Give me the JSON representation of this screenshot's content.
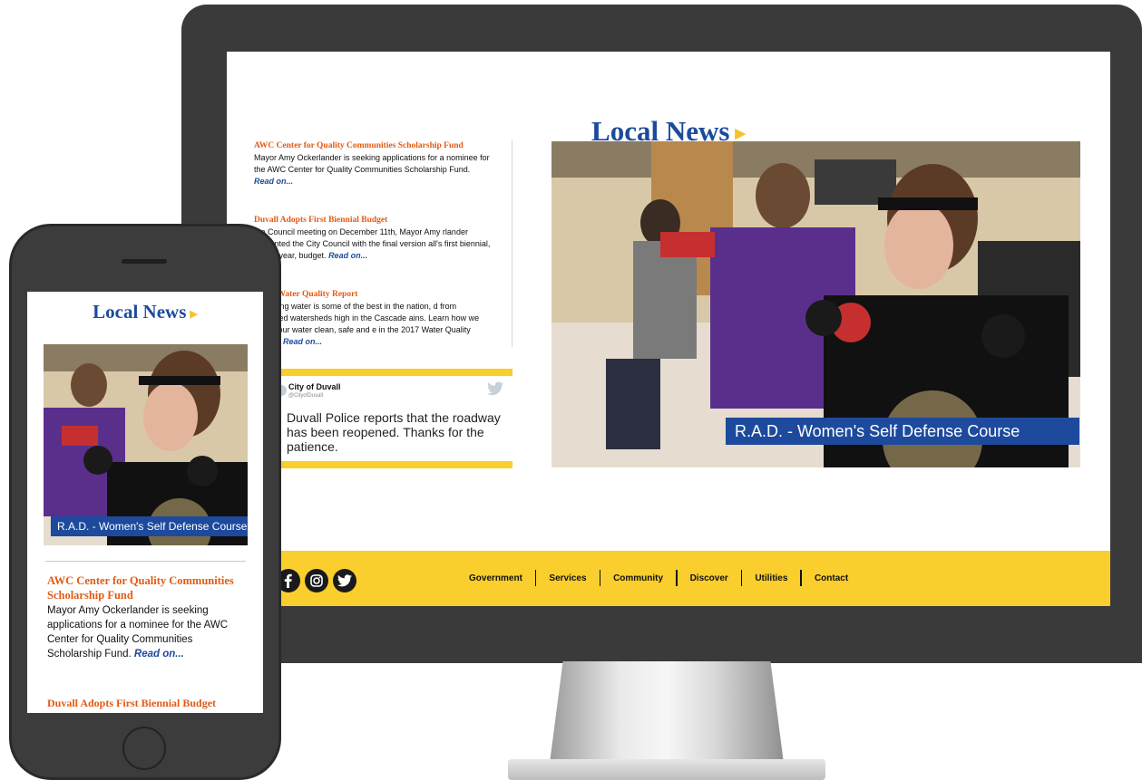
{
  "colors": {
    "brand_blue": "#1d4a9c",
    "accent_yellow": "#f9ce2d",
    "headline_orange": "#e35a12"
  },
  "desktop": {
    "title": "Local News",
    "news": [
      {
        "title": "AWC Center for Quality Communities Scholarship Fund",
        "body": "Mayor Amy Ockerlander is seeking applications for a nominee for the AWC Center for Quality Communities Scholarship Fund.",
        "read_on": "Read on..."
      },
      {
        "title": "Duvall Adopts First Biennial Budget",
        "body": "the Council meeting on December 11th, Mayor Amy rlander presented the City Council with the final version all's first biennial, or two-year, budget.",
        "read_on": "Read on..."
      },
      {
        "title": "nnual Water Quality Report",
        "body": "s drinking water is some of the best in the nation, d from protected watersheds high in the Cascade ains. Learn how we keep your water clean, safe and e in the 2017 Water Quality Report.",
        "read_on": "Read on..."
      }
    ],
    "tweet": {
      "name": "City of Duvall",
      "handle": "@CityofDuvall",
      "text": "Duvall Police reports that the roadway has been reopened. Thanks for the patience.",
      "icon": "twitter-bird-icon"
    },
    "hero_caption": "R.A.D. - Women's Self Defense Course",
    "footer": {
      "social_icons": [
        "facebook-icon",
        "instagram-icon",
        "twitter-icon"
      ],
      "nav": [
        "Government",
        "Services",
        "Community",
        "Discover",
        "Utilities",
        "Contact"
      ]
    }
  },
  "mobile": {
    "title": "Local News",
    "hero_caption": "R.A.D. - Women's Self Defense Course",
    "news": [
      {
        "title": "AWC Center for Quality Communities Scholarship Fund",
        "body": "Mayor Amy Ockerlander is seeking applications for a nominee for the AWC Center for Quality Communities Scholarship Fund.",
        "read_on": "Read on..."
      },
      {
        "title": "Duvall Adopts First Biennial Budget"
      }
    ]
  }
}
